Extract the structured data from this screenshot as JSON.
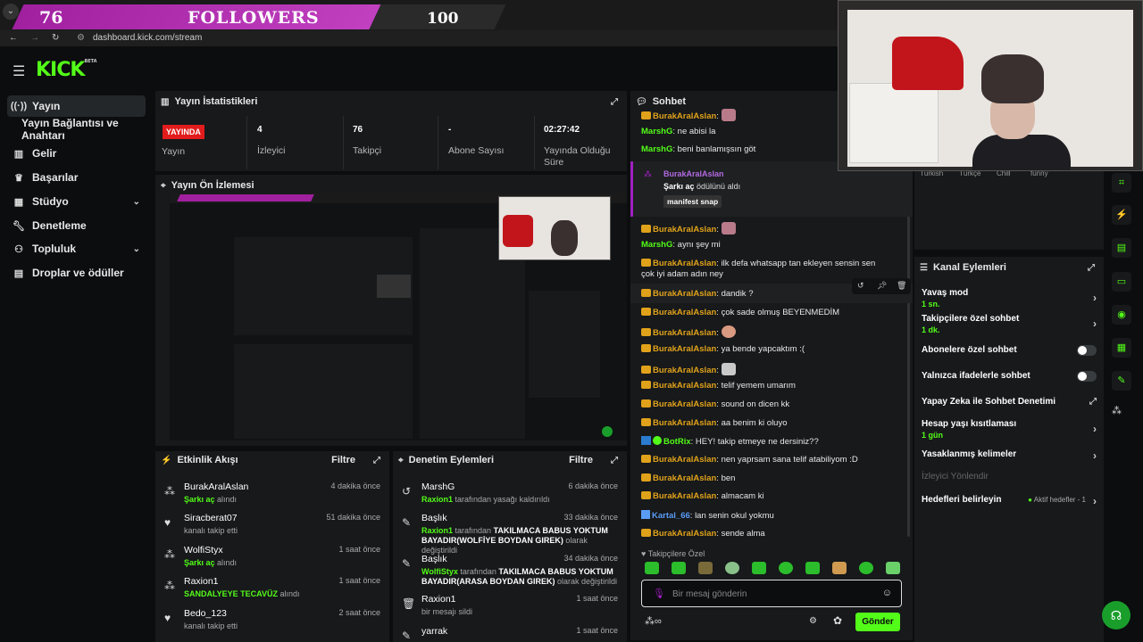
{
  "overlay": {
    "current": "76",
    "label": "FOLLOWERS",
    "goal": "100"
  },
  "browser": {
    "url": "dashboard.kick.com/stream"
  },
  "logo": "KICK",
  "logo_badge": "BETA",
  "sidebar": {
    "items": [
      {
        "label": "Yayın",
        "icon": "broadcast-icon"
      },
      {
        "label": "Yayın Bağlantısı ve Anahtarı",
        "icon": ""
      },
      {
        "label": "Gelir",
        "icon": "bar-chart-icon"
      },
      {
        "label": "Başarılar",
        "icon": "trophy-icon"
      },
      {
        "label": "Stüdyo",
        "icon": "grid-icon"
      },
      {
        "label": "Denetleme",
        "icon": "wrench-icon"
      },
      {
        "label": "Topluluk",
        "icon": "people-icon"
      },
      {
        "label": "Droplar ve ödüller",
        "icon": "gift-icon"
      }
    ]
  },
  "stats": {
    "title": "Yayın İstatistikleri",
    "live_badge": "YAYINDA",
    "live_label": "Yayın",
    "viewers_value": "4",
    "viewers_label": "İzleyici",
    "followers_value": "76",
    "followers_label": "Takipçi",
    "subs_value": "-",
    "subs_label": "Abone Sayısı",
    "uptime_value": "02:27:42",
    "uptime_label": "Yayında Olduğu Süre"
  },
  "preview": {
    "title": "Yayın Ön İzlemesi"
  },
  "activity": {
    "title": "Etkinlik Akışı",
    "filter": "Filtre",
    "rows": [
      {
        "name": "BurakAralAslan",
        "sub_prefix": "",
        "sub_green": "Şarkı aç",
        "sub_suffix": " alındı",
        "time": "4 dakika önce",
        "icon": "gift-icon"
      },
      {
        "name": "Siracberat07",
        "sub_prefix": "kanalı takip etti",
        "sub_green": "",
        "sub_suffix": "",
        "time": "51 dakika önce",
        "icon": "heart-icon"
      },
      {
        "name": "WolfiStyx",
        "sub_prefix": "",
        "sub_green": "Şarkı aç",
        "sub_suffix": " alındı",
        "time": "1 saat önce",
        "icon": "gift-icon"
      },
      {
        "name": "Raxion1",
        "sub_prefix": "",
        "sub_green": "SANDALYEYE TECAVÜZ",
        "sub_suffix": " alındı",
        "time": "1 saat önce",
        "icon": "gift-icon"
      },
      {
        "name": "Bedo_123",
        "sub_prefix": "kanalı takip etti",
        "sub_green": "",
        "sub_suffix": "",
        "time": "2 saat önce",
        "icon": "heart-icon"
      }
    ]
  },
  "moderation": {
    "title": "Denetim Eylemleri",
    "filter": "Filtre",
    "rows": [
      {
        "name": "MarshG",
        "line1_green": "Raxion1",
        "line1_rest": " tarafından yasağı kaldırıldı",
        "line2": "",
        "time": "6 dakika önce",
        "icon": "undo-icon"
      },
      {
        "name": "Başlık",
        "line1_green": "Raxion1",
        "line1_rest": " tarafından ",
        "line1_bold": "TAKILMACA BABUS YOKTUM",
        "line2_bold": "BAYADIR(WOLFİYE BOYDAN GIREK)",
        "line2_rest": " olarak değiştirildi",
        "time": "33 dakika önce",
        "icon": "pencil-icon"
      },
      {
        "name": "Başlık",
        "line1_green": "WolfiStyx",
        "line1_rest": " tarafından ",
        "line1_bold": "TAKILMACA BABUS YOKTUM",
        "line2_bold": "BAYADIR(ARASA BOYDAN GIREK)",
        "line2_rest": " olarak değiştirildi",
        "time": "34 dakika önce",
        "icon": "pencil-icon"
      },
      {
        "name": "Raxion1",
        "line1_green": "",
        "line1_rest": "bir mesajı sildi",
        "line2": "",
        "time": "1 saat önce",
        "icon": "trash-icon"
      },
      {
        "name": "yarrak",
        "line1_green": "",
        "line1_rest": "",
        "line2": "",
        "time": "1 saat önce",
        "icon": "pencil-icon"
      }
    ]
  },
  "chat": {
    "title": "Sohbet",
    "messages": [
      {
        "user": "BurakAralAslan",
        "color": "#e0a21a",
        "text": "",
        "crown": true,
        "emote": true
      },
      {
        "user": "MarshG",
        "color": "#53fc18",
        "text": "ne abisi la",
        "crown": false
      },
      {
        "user": "MarshG",
        "color": "#53fc18",
        "text": "beni banlamışsın göt",
        "crown": false
      },
      {
        "user": "BurakAralAslan",
        "color": "#e0a21a",
        "text": "",
        "crown": true,
        "emote": true
      },
      {
        "user": "MarshG",
        "color": "#53fc18",
        "text": "aynı şey mi",
        "crown": false
      },
      {
        "user": "BurakAralAslan",
        "color": "#e0a21a",
        "text": "ilk defa whatsapp tan ekleyen sensin sen çok iyi adam adın ney",
        "crown": true
      },
      {
        "user": "BurakAralAslan",
        "color": "#e0a21a",
        "text": "dandik ?",
        "crown": true
      },
      {
        "user": "BurakAralAslan",
        "color": "#e0a21a",
        "text": "çok sade olmuş BEYENMEDİM",
        "crown": true
      },
      {
        "user": "BurakAralAslan",
        "color": "#e0a21a",
        "text": "",
        "crown": true,
        "emote": true
      },
      {
        "user": "BurakAralAslan",
        "color": "#e0a21a",
        "text": "ya bende yapcaktım :(",
        "crown": true
      },
      {
        "user": "BurakAralAslan",
        "color": "#e0a21a",
        "text": "",
        "crown": true,
        "emote": true
      },
      {
        "user": "BurakAralAslan",
        "color": "#e0a21a",
        "text": "telif yemem umarım",
        "crown": true
      },
      {
        "user": "BurakAralAslan",
        "color": "#e0a21a",
        "text": "sound on dicen kk",
        "crown": true
      },
      {
        "user": "BurakAralAslan",
        "color": "#e0a21a",
        "text": "aa benim ki oluyo",
        "crown": true
      },
      {
        "user": "BotRix",
        "color": "#53fc18",
        "text": "HEY! takip etmeye ne dersiniz??",
        "crown": false
      },
      {
        "user": "BurakAralAslan",
        "color": "#e0a21a",
        "text": "nen yaprsam sana telif atabiliyom :D",
        "crown": true
      },
      {
        "user": "BurakAralAslan",
        "color": "#e0a21a",
        "text": "ben",
        "crown": true
      },
      {
        "user": "BurakAralAslan",
        "color": "#e0a21a",
        "text": "almacam ki",
        "crown": true
      },
      {
        "user": "Kartal_66",
        "color": "#5a9cf5",
        "text": "lan senin okul yokmu",
        "crown": false
      },
      {
        "user": "BurakAralAslan",
        "color": "#e0a21a",
        "text": "sende alma",
        "crown": true
      }
    ],
    "redeem": {
      "user": "BurakAralAslan",
      "line1_bold": "Şarkı aç",
      "line1_rest": " ödülünü aldı",
      "tag": "manifest snap"
    },
    "followers_only": "Takipçilere Özel",
    "input_placeholder": "Bir mesaj gönderin",
    "send": "Gönder"
  },
  "tags": [
    "Türkish",
    "Türkçe",
    "Chill",
    "funny"
  ],
  "kanal": {
    "title": "Kanal Eylemleri",
    "slow_mode": "Yavaş mod",
    "slow_mode_value": "1 sn.",
    "followers_chat": "Takipçilere özel sohbet",
    "followers_chat_value": "1 dk.",
    "subs_chat": "Abonelere özel sohbet",
    "emotes_chat": "Yalnızca ifadelerle sohbet",
    "ai_mod": "Yapay Zeka ile Sohbet Denetimi",
    "age_limit": "Hesap yaşı kısıtlaması",
    "age_limit_value": "1 gün",
    "banned_words": "Yasaklanmış kelimeler",
    "redirect": "İzleyici Yönlendir",
    "goals": "Hedefleri belirleyin",
    "goals_active": "Aktif hedefler - 1"
  },
  "colors": {
    "accent": "#53fc18",
    "live": "#e21c1c",
    "panel": "#17191b"
  }
}
